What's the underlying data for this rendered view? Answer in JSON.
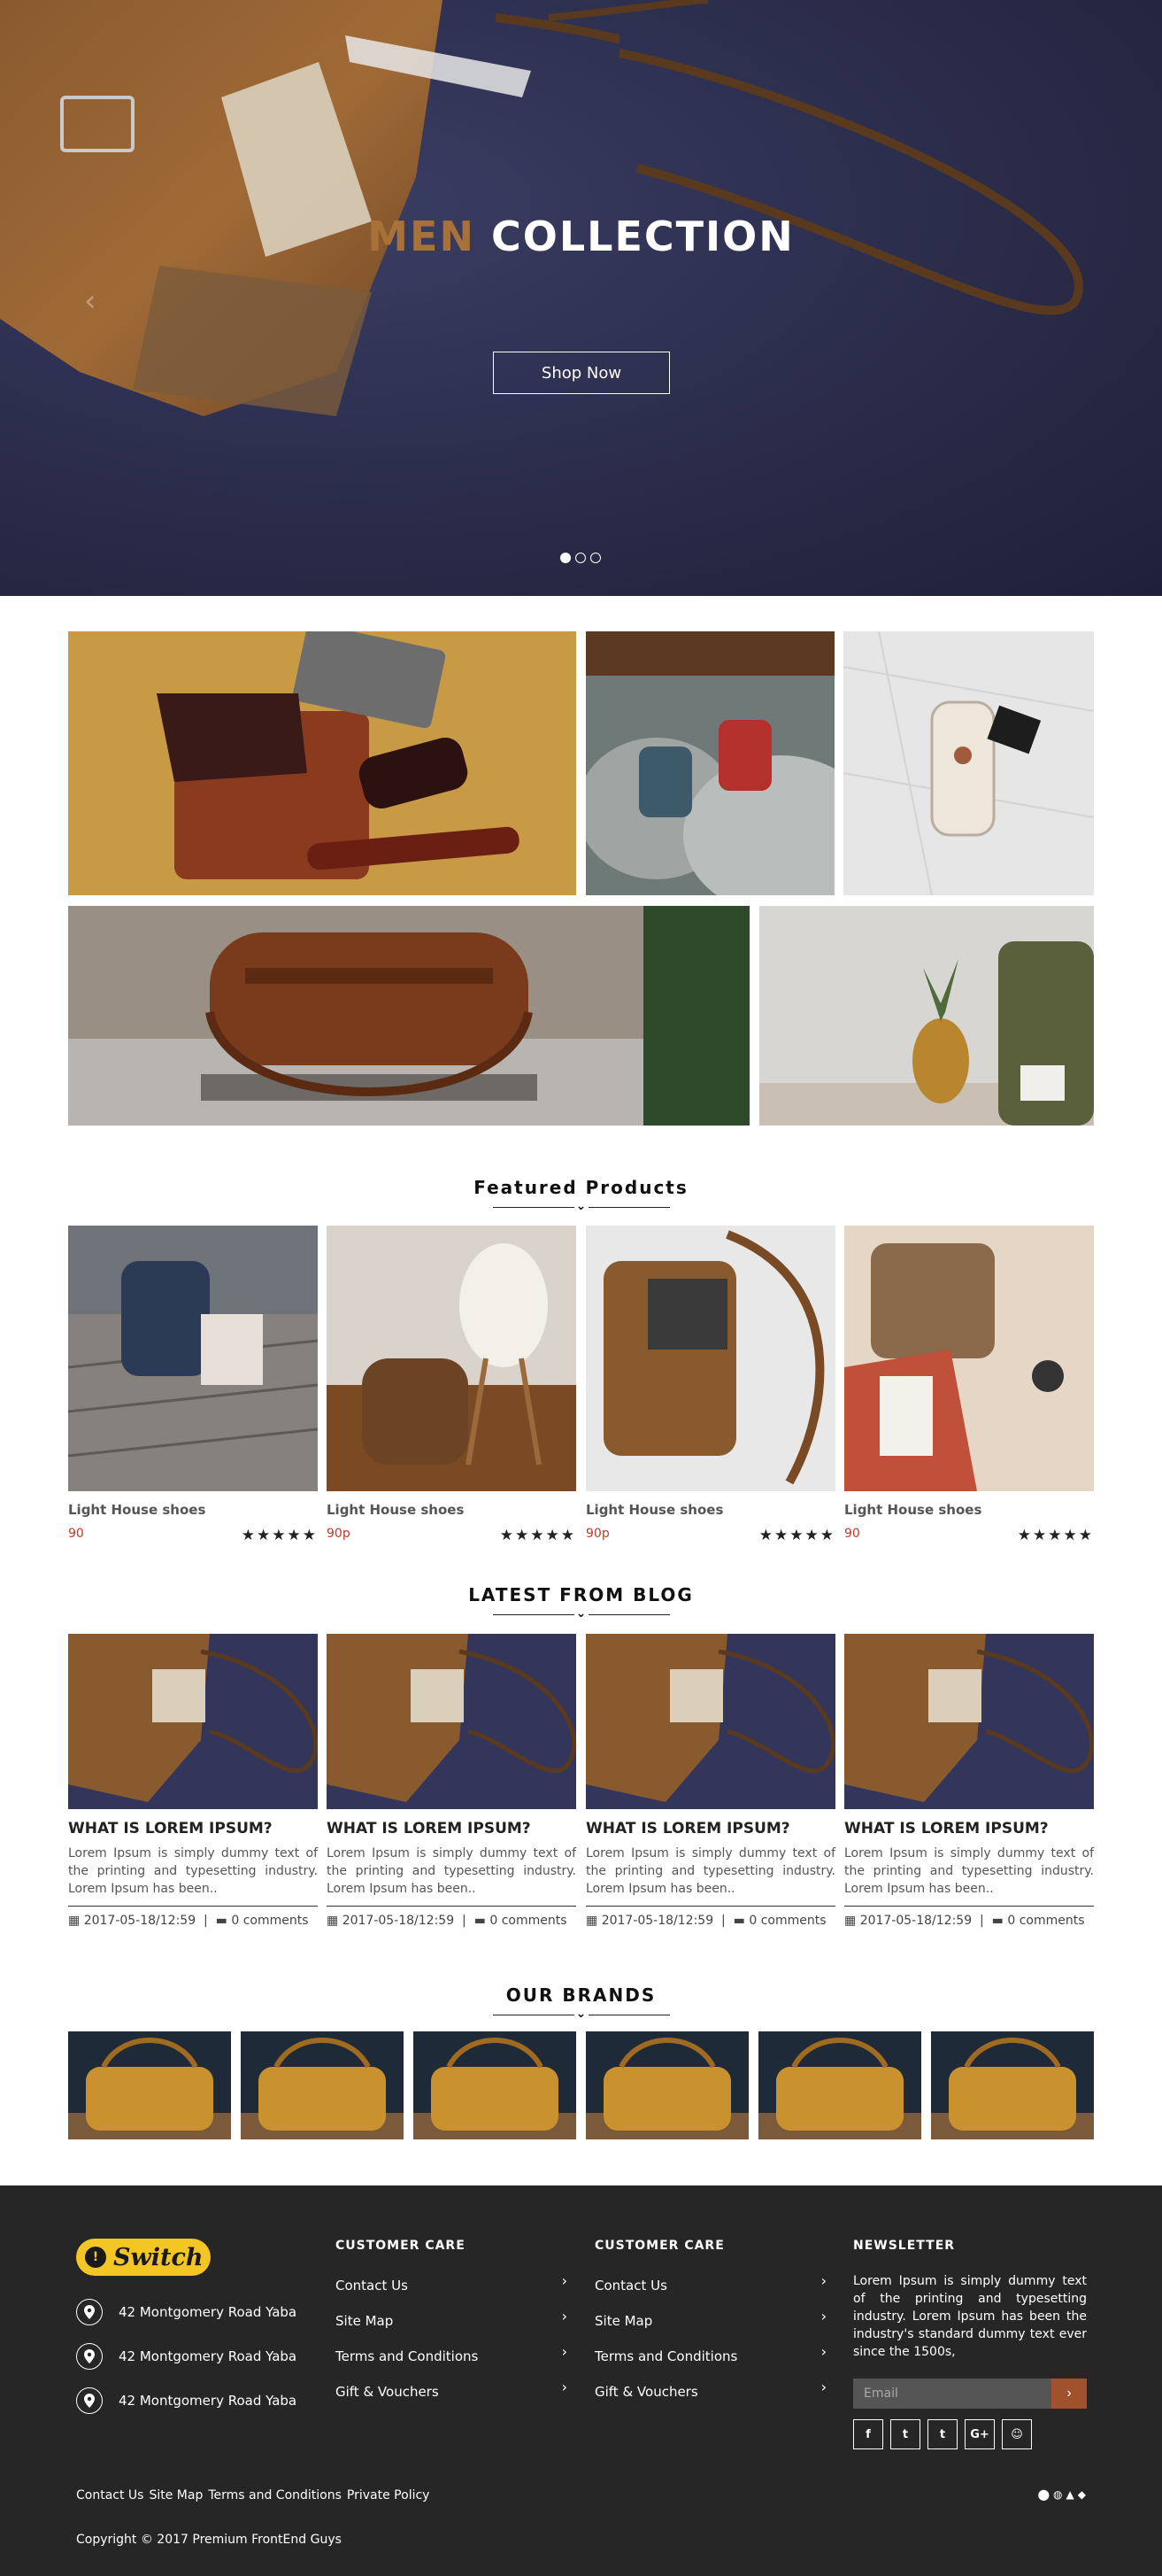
{
  "hero": {
    "title_accent": "MEN",
    "title_rest": "COLLECTION",
    "button": "Shop Now",
    "slides": 3,
    "active_slide": 1
  },
  "featured": {
    "heading": "Featured Products",
    "products": [
      {
        "name": "Light House shoes",
        "price": "90",
        "stars": "★★★★★"
      },
      {
        "name": "Light House shoes",
        "price": "90p",
        "stars": "★★★★★"
      },
      {
        "name": "Light House shoes",
        "price": "90p",
        "stars": "★★★★★"
      },
      {
        "name": "Light House shoes",
        "price": "90",
        "stars": "★★★★★"
      }
    ]
  },
  "blog": {
    "heading": "LATEST FROM BLOG",
    "posts": [
      {
        "title": "WHAT IS LOREM IPSUM?",
        "excerpt": "Lorem Ipsum is simply dummy text of the printing and typesetting industry. Lorem Ipsum has been..",
        "date": "2017-05-18/12:59",
        "comments": "0 comments"
      },
      {
        "title": "WHAT IS LOREM IPSUM?",
        "excerpt": "Lorem Ipsum is simply dummy text of the printing and typesetting industry. Lorem Ipsum has been..",
        "date": "2017-05-18/12:59",
        "comments": "0 comments"
      },
      {
        "title": "WHAT IS LOREM IPSUM?",
        "excerpt": "Lorem Ipsum is simply dummy text of the printing and typesetting industry. Lorem Ipsum has been..",
        "date": "2017-05-18/12:59",
        "comments": "0 comments"
      },
      {
        "title": "WHAT IS LOREM IPSUM?",
        "excerpt": "Lorem Ipsum is simply dummy text of the printing and typesetting industry. Lorem Ipsum has been..",
        "date": "2017-05-18/12:59",
        "comments": "0 comments"
      }
    ]
  },
  "brands": {
    "heading": "OUR BRANDS",
    "count": 6
  },
  "footer": {
    "logo": "Switch",
    "addresses": [
      "42 Montgomery Road Yaba",
      "42 Montgomery Road Yaba",
      "42 Montgomery Road Yaba"
    ],
    "columns": [
      {
        "heading": "CUSTOMER CARE",
        "links": [
          "Contact Us",
          "Site Map",
          "Terms and Conditions",
          "Gift & Vouchers"
        ]
      },
      {
        "heading": "CUSTOMER CARE",
        "links": [
          "Contact Us",
          "Site Map",
          "Terms and Conditions",
          "Gift & Vouchers"
        ]
      }
    ],
    "newsletter": {
      "heading": "NEWSLETTER",
      "text": "Lorem Ipsum is simply dummy text of the printing and typesetting industry. Lorem Ipsum has been the industry's standard dummy text ever since the 1500s,",
      "placeholder": "Email"
    },
    "socials": [
      "f",
      "t",
      "t",
      "G+",
      "☺"
    ],
    "bottom_links": [
      "Contact Us",
      "Site Map",
      "Terms and Conditions",
      "Private Policy"
    ],
    "copyright": "Copyright © 2017 Premium FrontEnd Guys"
  },
  "colors": {
    "accent": "#a87137",
    "price": "#c0392b",
    "footer_bg": "#262626",
    "logo_bg": "#f3c623"
  }
}
